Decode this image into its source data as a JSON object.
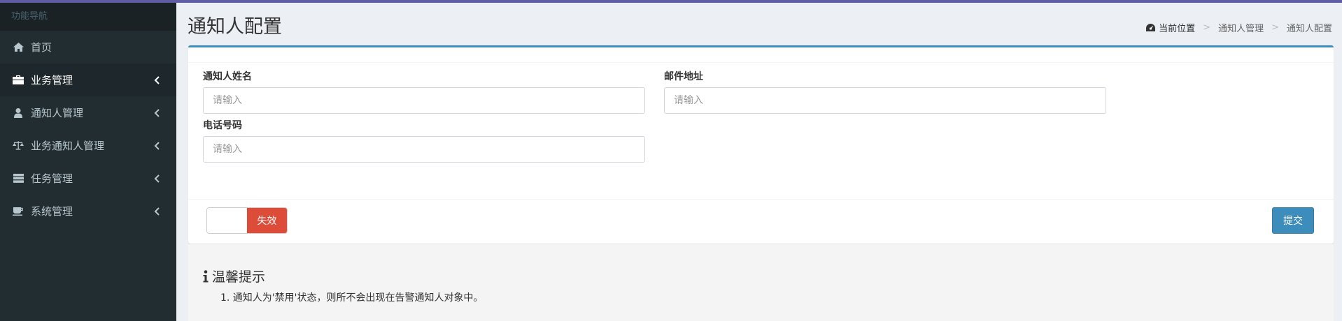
{
  "sidebar": {
    "header": "功能导航",
    "items": [
      {
        "label": "首页",
        "icon": "home-icon"
      },
      {
        "label": "业务管理",
        "icon": "briefcase-icon"
      },
      {
        "label": "通知人管理",
        "icon": "user-icon"
      },
      {
        "label": "业务通知人管理",
        "icon": "balance-scale-icon"
      },
      {
        "label": "任务管理",
        "icon": "server-icon"
      },
      {
        "label": "系统管理",
        "icon": "coffee-icon"
      }
    ]
  },
  "header": {
    "title": "通知人配置",
    "breadcrumb": [
      "当前位置",
      "通知人管理",
      "通知人配置"
    ]
  },
  "form": {
    "name_label": "通知人姓名",
    "name_placeholder": "请输入",
    "email_label": "邮件地址",
    "email_placeholder": "请输入",
    "phone_label": "电话号码",
    "phone_placeholder": "请输入"
  },
  "footer": {
    "toggle_off_label": "失效",
    "submit_label": "提交"
  },
  "tips": {
    "title": "温馨提示",
    "items": [
      "1. 通知人为'禁用'状态，则所不会出现在告警通知人对象中。"
    ]
  },
  "colors": {
    "sidebar_bg": "#222d32",
    "accent": "#3c8dbc",
    "danger": "#dd4b39",
    "top_strip": "#605ca8"
  }
}
